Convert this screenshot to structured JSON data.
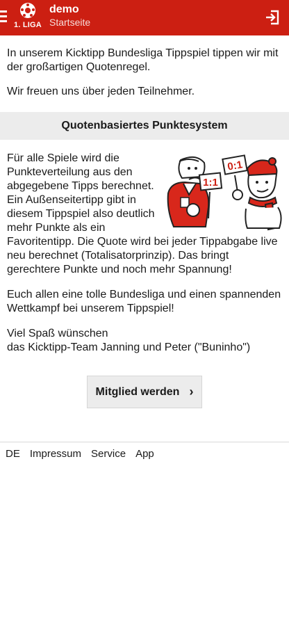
{
  "header": {
    "logo_text": "1. LIGA",
    "title": "demo",
    "subtitle": "Startseite",
    "icons": {
      "menu": "hamburger-icon",
      "logo": "bundesliga-ball-icon",
      "login": "login-icon"
    },
    "colors": {
      "brand": "#cc1f12"
    }
  },
  "intro": {
    "paragraph1": "In unserem Kicktipp Bundesliga Tippspiel tippen wir mit der großartigen Quotenregel.",
    "paragraph2": "Wir freuen uns über jeden Teilnehmer."
  },
  "section": {
    "title": "Quotenbasiertes Punktesystem"
  },
  "illustration": {
    "sign_left": "1:1",
    "sign_right": "0:1"
  },
  "body": {
    "paragraph1": "Für alle Spiele wird die Punkteverteilung aus den abgegebene Tipps berechnet. Ein Außenseitertipp gibt in diesem Tippspiel also deutlich mehr Punkte als ein Favoritentipp. Die Quote wird bei jeder Tippabgabe live neu berechnet (Totalisatorprinzip). Das bringt gerechtere Punkte und noch mehr Spannung!",
    "paragraph2": "Euch allen eine tolle Bundesliga und einen spannenden Wettkampf bei unserem Tippspiel!",
    "greeting_line1": "Viel Spaß wünschen",
    "greeting_line2": "das Kicktipp-Team Janning und Peter (\"Buninho\")"
  },
  "cta": {
    "label": "Mitglied werden",
    "chevron": "›"
  },
  "footer": {
    "links": [
      "DE",
      "Impressum",
      "Service",
      "App"
    ]
  }
}
